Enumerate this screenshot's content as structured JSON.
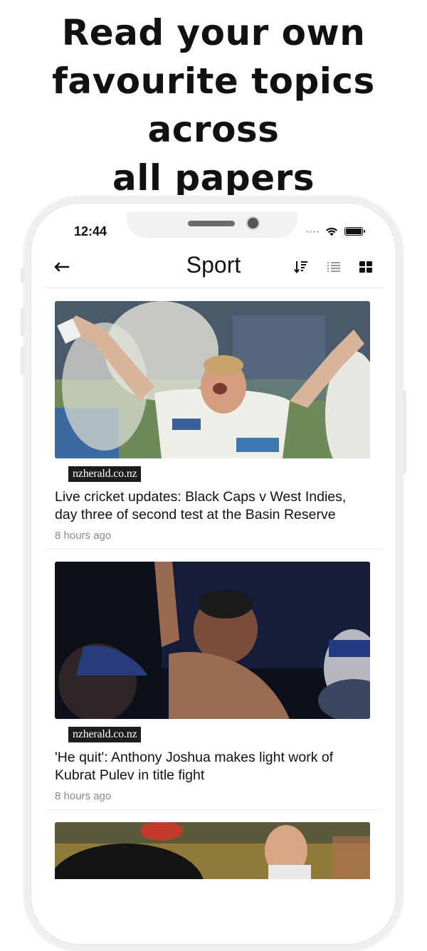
{
  "promo": {
    "line1": "Read your own",
    "line2": "favourite topics across",
    "line3": "all papers"
  },
  "status_bar": {
    "time": "12:44"
  },
  "app_bar": {
    "title": "Sport"
  },
  "articles": [
    {
      "source": "nzherald.co.nz",
      "title": "Live cricket updates: Black Caps v West Indies, day three of second test at the Basin Reserve",
      "time": "8 hours ago"
    },
    {
      "source": "nzherald.co.nz",
      "title": "'He quit': Anthony Joshua makes light work of Kubrat Pulev in title fight",
      "time": "8 hours ago"
    }
  ],
  "icons": {
    "back": "back-arrow-icon",
    "sort": "sort-icon",
    "list_view": "list-view-icon",
    "grid_view": "grid-view-icon",
    "wifi": "wifi-icon",
    "battery": "battery-icon",
    "signal": "signal-icon"
  }
}
